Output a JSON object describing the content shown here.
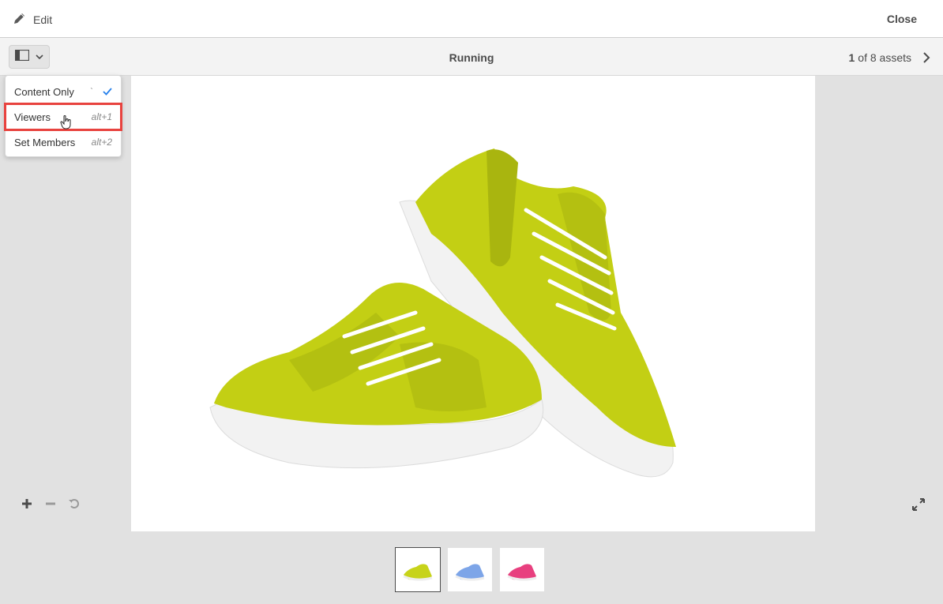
{
  "header": {
    "edit_label": "Edit",
    "close_label": "Close"
  },
  "toolbar": {
    "title": "Running",
    "pager_current": "1",
    "pager_text": "of 8 assets"
  },
  "menu": {
    "items": [
      {
        "label": "Content Only",
        "shortcut": "`",
        "checked": true
      },
      {
        "label": "Viewers",
        "shortcut": "alt+1",
        "checked": false
      },
      {
        "label": "Set Members",
        "shortcut": "alt+2",
        "checked": false
      }
    ]
  },
  "thumbnails": [
    {
      "color": "#c7d31a",
      "selected": true
    },
    {
      "color": "#7da5e8",
      "selected": false
    },
    {
      "color": "#e8407f",
      "selected": false
    }
  ],
  "colors": {
    "shoe": "#c3cf14",
    "shoe_dark": "#9aa60e",
    "sole": "#f2f2f2",
    "check": "#2680eb",
    "highlight": "#e8433f"
  }
}
